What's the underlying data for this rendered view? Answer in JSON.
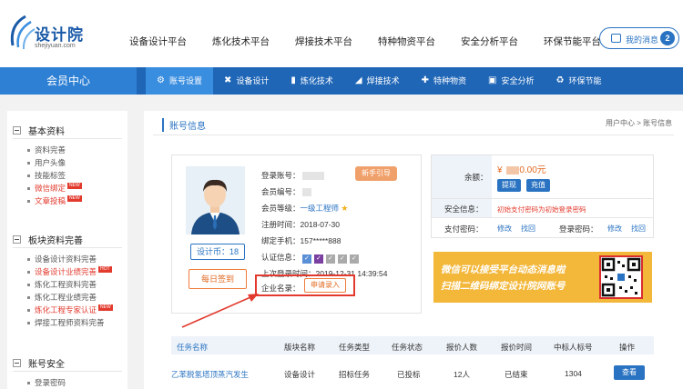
{
  "header": {
    "logo_text": "设计院",
    "logo_sub": "shejiyuan.com",
    "nav": [
      "设备设计平台",
      "炼化技术平台",
      "焊接技术平台",
      "特种物资平台",
      "安全分析平台",
      "环保节能平台"
    ],
    "messages_label": "我的消息",
    "messages_count": "2"
  },
  "subnav": {
    "member_center": "会员中心",
    "items": [
      {
        "label": "账号设置",
        "icon": "gear-icon"
      },
      {
        "label": "设备设计",
        "icon": "tools-icon"
      },
      {
        "label": "炼化技术",
        "icon": "factory-icon"
      },
      {
        "label": "焊接技术",
        "icon": "torch-icon"
      },
      {
        "label": "特种物资",
        "icon": "materials-icon"
      },
      {
        "label": "安全分析",
        "icon": "monitor-icon"
      },
      {
        "label": "环保节能",
        "icon": "eco-icon"
      }
    ]
  },
  "sidebar": {
    "basic": {
      "title": "基本资料",
      "items": [
        "资料完善",
        "用户头像",
        "技能标签",
        "微信绑定",
        "文章投稿"
      ],
      "new_badge": "NEW"
    },
    "board": {
      "title": "板块资料完善",
      "items": [
        "设备设计资料完善",
        "设备设计业绩完善",
        "炼化工程资料完善",
        "炼化工程业绩完善",
        "炼化工程专家认证",
        "焊接工程师资料完善"
      ],
      "hot_badge": "HOT"
    },
    "security": {
      "title": "账号安全",
      "items": [
        "登录密码"
      ]
    }
  },
  "main": {
    "title": "账号信息",
    "breadcrumb": "用户中心 > 账号信息",
    "profile": {
      "coin_label": "设计币：18",
      "sign_label": "每日签到",
      "newbie_label": "新手引导",
      "account_label": "登录账号：",
      "member_no_label": "会员编号：",
      "level_label": "会员等级：",
      "level_value": "一级工程师",
      "reg_label": "注册时间：",
      "reg_value": "2018-07-30",
      "phone_label": "绑定手机：",
      "phone_value": "157*****888",
      "cert_label": "认证信息：",
      "last_login_label": "上次登录时间：",
      "last_login_value": "2019-12-31 14:39:54",
      "company_label": "企业名录：",
      "apply_label": "申请录入"
    },
    "account": {
      "balance_label": "余额：",
      "balance_currency": "¥",
      "balance_value": "0.00元",
      "withdraw": "提现",
      "recharge": "充值",
      "safety_label": "安全信息：",
      "safety_value": "初始支付密码为初始登录密码",
      "pay_pwd_label": "支付密码：",
      "login_pwd_label": "登录密码：",
      "modify": "修改",
      "retrieve": "找回"
    },
    "banner": {
      "line1": "微信可以接受平台动态消息啦",
      "line2": "扫描二维码绑定设计院网账号"
    },
    "tasks": {
      "headers": [
        "任务名称",
        "版块名称",
        "任务类型",
        "任务状态",
        "报价人数",
        "报价时间",
        "中标人标号",
        "操作"
      ],
      "rows": [
        {
          "name": "乙苯脱氢塔顶蒸汽发生",
          "board": "设备设计",
          "type": "招标任务",
          "status": "已投标",
          "count": "12人",
          "time": "已结束",
          "bid_no": "1304",
          "action": "查看"
        }
      ]
    }
  }
}
